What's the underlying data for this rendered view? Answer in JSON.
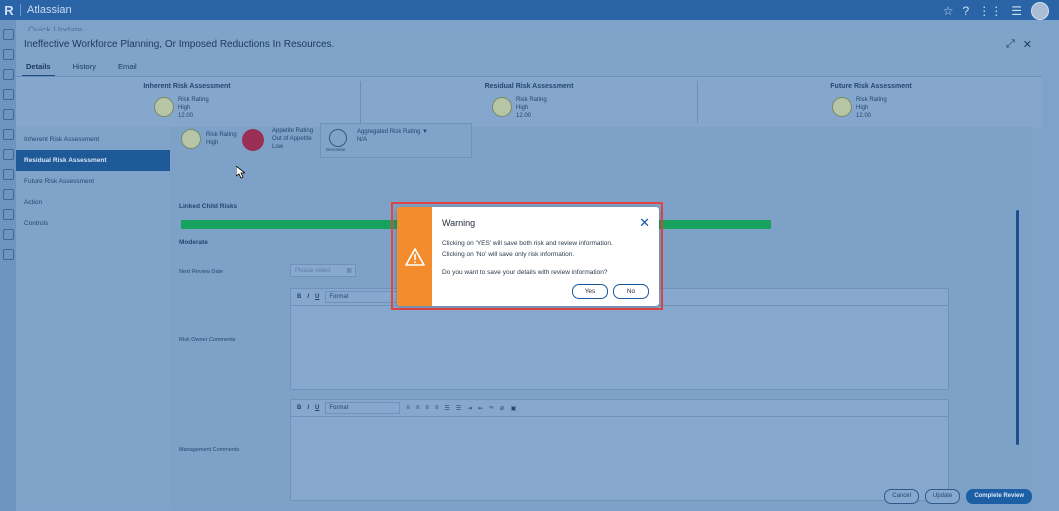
{
  "topbar": {
    "logo": "R",
    "brand": "Atlassian",
    "icons": [
      "star-icon",
      "help-icon",
      "apps-grid-icon",
      "menu-icon",
      "avatar"
    ]
  },
  "background_title": "Quick Update",
  "panel": {
    "title": "Ineffective Workforce Planning, Or Imposed Reductions In Resources.",
    "tabs": [
      "Details",
      "History",
      "Email"
    ],
    "active_tab": "Details"
  },
  "ribbon": [
    {
      "heading": "Inherent Risk Assessment",
      "label": "Risk Rating",
      "value": "High",
      "score": "12.00"
    },
    {
      "heading": "Residual Risk Assessment",
      "label": "Risk Rating",
      "value": "High",
      "score": "12.00"
    },
    {
      "heading": "Future Risk Assessment",
      "label": "Risk Rating",
      "value": "High",
      "score": "12.00"
    }
  ],
  "sidenav": {
    "items": [
      "Inherent Risk Assessment",
      "Residual Risk Assessment",
      "Future Risk Assessment",
      "Action",
      "Controls"
    ],
    "active": "Residual Risk Assessment"
  },
  "content": {
    "risk_rating_label": "Risk Rating",
    "risk_rating_value": "High",
    "appetite_label": "Appetite Rating",
    "appetite_status": "Out of Appetite",
    "appetite_value": "Low",
    "agg_label": "Aggregated Risk Rating",
    "agg_icon_caption": "Decrease",
    "agg_value": "N/A",
    "linked_child_risks": "Linked Child Risks",
    "moderate": "Moderate",
    "next_review_label": "Next Review Date",
    "next_review_placeholder": "Please select",
    "owner_comments_label": "Risk Owner Comments",
    "mgmt_comments_label": "Management Comments",
    "editor_format": "Format",
    "toolbar_bold": "B",
    "toolbar_italic": "I",
    "toolbar_underline": "U"
  },
  "footer": {
    "cancel": "Cancel",
    "update": "Update",
    "complete": "Complete Review"
  },
  "modal": {
    "title": "Warning",
    "line1": "Clicking on 'YES' will save both risk and review information.",
    "line2": "Clicking on 'No' will save only risk information.",
    "question": "Do you want to save your details with review information?",
    "yes": "Yes",
    "no": "No"
  },
  "colors": {
    "warning_strip": "#f28c2c",
    "highlight_border": "#e04444",
    "progress_green": "#16a35d",
    "primary_blue": "#1d5fa5",
    "appetite_dot": "#9a2f55"
  }
}
